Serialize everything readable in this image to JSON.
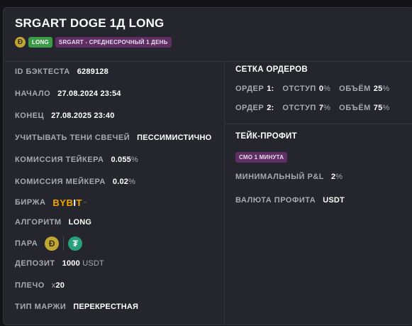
{
  "title": "SRGART DOGE 1Д LONG",
  "tags": {
    "coin_icon": "dogecoin-icon",
    "direction": "LONG",
    "strategy": "SRGART - СРЕДНЕСРОЧНЫЙ 1 ДЕНЬ"
  },
  "left": {
    "backtest_id": {
      "label": "ID БЭКТЕСТА",
      "value": "6289128"
    },
    "start": {
      "label": "НАЧАЛО",
      "value": "27.08.2024 23:54"
    },
    "end": {
      "label": "КОНЕЦ",
      "value": "27.08.2025 23:40"
    },
    "shadows": {
      "label": "УЧИТЫВАТЬ ТЕНИ СВЕЧЕЙ",
      "value": "ПЕССИМИСТИЧНО"
    },
    "taker_fee": {
      "label": "КОМИССИЯ ТЕЙКЕРА",
      "value": "0.055",
      "unit": "%"
    },
    "maker_fee": {
      "label": "КОМИССИЯ МЕЙКЕРА",
      "value": "0.02",
      "unit": "%"
    },
    "exchange": {
      "label": "БИРЖА",
      "logo_a": "BYB",
      "logo_bar": "I",
      "logo_b": "T"
    },
    "algorithm": {
      "label": "АЛГОРИТМ",
      "value": "LONG"
    },
    "pair": {
      "label": "ПАРА",
      "base_icon": "dogecoin-icon",
      "quote_icon": "tether-icon",
      "base_glyph": "Ð",
      "quote_glyph": "₮"
    },
    "deposit": {
      "label": "ДЕПОЗИТ",
      "value": "1000",
      "unit": "USDT"
    },
    "leverage": {
      "label": "ПЛЕЧО",
      "prefix": "x",
      "value": "20"
    },
    "margin": {
      "label": "ТИП МАРЖИ",
      "value": "ПЕРЕКРЕСТНАЯ"
    }
  },
  "orders": {
    "title": "СЕТКА ОРДЕРОВ",
    "rows": [
      {
        "label": "ОРДЕР",
        "num": "1:",
        "offset_label": "ОТСТУП",
        "offset": "0",
        "offset_unit": "%",
        "volume_label": "ОБЪЁМ",
        "volume": "25",
        "volume_unit": "%"
      },
      {
        "label": "ОРДЕР",
        "num": "2:",
        "offset_label": "ОТСТУП",
        "offset": "7",
        "offset_unit": "%",
        "volume_label": "ОБЪЁМ",
        "volume": "75",
        "volume_unit": "%"
      }
    ]
  },
  "take_profit": {
    "title": "ТЕЙК-ПРОФИТ",
    "tag": "СМО 1 МИНУТА",
    "min_pnl": {
      "label": "МИНИМАЛЬНЫЙ P&L",
      "value": "2",
      "unit": "%"
    },
    "currency": {
      "label": "ВАЛЮТА ПРОФИТА",
      "value": "USDT"
    }
  },
  "colors": {
    "long_tag": "#3c9b46",
    "strategy_tag": "#5f2e63",
    "bybit": "#f7a600",
    "doge": "#c2a633",
    "tether": "#26a17b"
  }
}
